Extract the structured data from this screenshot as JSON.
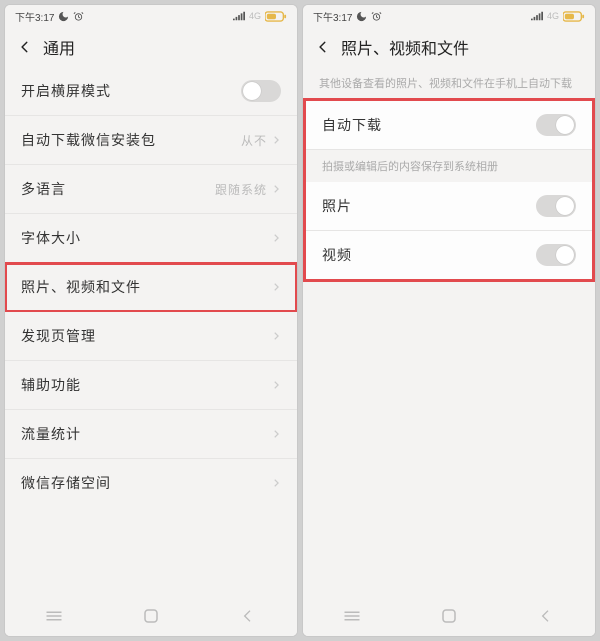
{
  "left": {
    "status": {
      "time": "下午3:17",
      "net": "4G"
    },
    "header": {
      "title": "通用"
    },
    "rows": [
      {
        "label": "开启横屏模式",
        "type": "toggle",
        "on": false
      },
      {
        "label": "自动下载微信安装包",
        "type": "value",
        "value": "从不"
      },
      {
        "label": "多语言",
        "type": "value",
        "value": "跟随系统"
      },
      {
        "label": "字体大小",
        "type": "nav"
      },
      {
        "label": "照片、视频和文件",
        "type": "nav",
        "highlight": true
      },
      {
        "label": "发现页管理",
        "type": "nav"
      },
      {
        "label": "辅助功能",
        "type": "nav"
      },
      {
        "label": "流量统计",
        "type": "nav"
      },
      {
        "label": "微信存储空间",
        "type": "nav"
      }
    ]
  },
  "right": {
    "status": {
      "time": "下午3:17",
      "net": "4G"
    },
    "header": {
      "title": "照片、视频和文件"
    },
    "note1": "其他设备查看的照片、视频和文件在手机上自动下载",
    "note2": "拍摄或编辑后的内容保存到系统相册",
    "rows": [
      {
        "label": "自动下载",
        "type": "toggle",
        "on": true
      },
      {
        "label": "照片",
        "type": "toggle",
        "on": true
      },
      {
        "label": "视频",
        "type": "toggle",
        "on": true
      }
    ]
  }
}
